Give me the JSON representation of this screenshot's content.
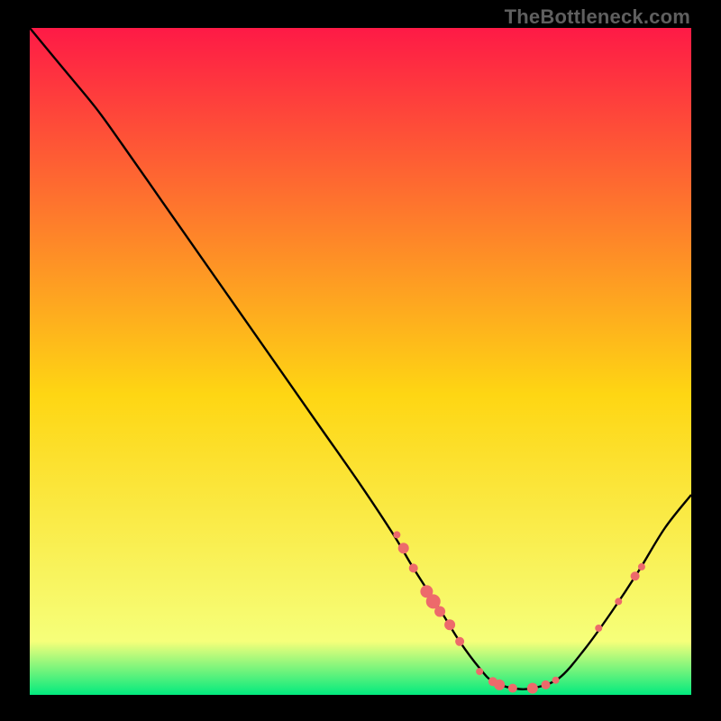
{
  "watermark": "TheBottleneck.com",
  "colors": {
    "grad_top": "#fe1a46",
    "grad_mid": "#fed613",
    "grad_bot": "#02ea7e",
    "curve": "#000000",
    "marker": "#ed6a6b",
    "frame": "#000000"
  },
  "chart_data": {
    "type": "line",
    "title": "",
    "xlabel": "",
    "ylabel": "",
    "xlim": [
      0,
      100
    ],
    "ylim": [
      0,
      100
    ],
    "series": [
      {
        "name": "bottleneck-curve",
        "x": [
          0,
          5,
          10,
          14,
          20,
          26,
          32,
          38,
          44,
          50,
          55,
          58,
          62,
          65,
          68,
          70,
          73,
          76,
          80,
          84,
          88,
          92,
          96,
          100
        ],
        "y": [
          100,
          94,
          88,
          82.5,
          74,
          65.5,
          57,
          48.5,
          40,
          31.5,
          24,
          19,
          12.8,
          8,
          4,
          2,
          1,
          1,
          2.5,
          7,
          12.5,
          18.5,
          25,
          30
        ]
      }
    ],
    "markers": [
      {
        "x": 55.5,
        "y": 24.0,
        "r": 4
      },
      {
        "x": 56.5,
        "y": 22.0,
        "r": 6
      },
      {
        "x": 58.0,
        "y": 19.0,
        "r": 5
      },
      {
        "x": 60.0,
        "y": 15.5,
        "r": 7
      },
      {
        "x": 61.0,
        "y": 14.0,
        "r": 8
      },
      {
        "x": 62.0,
        "y": 12.5,
        "r": 6
      },
      {
        "x": 63.5,
        "y": 10.5,
        "r": 6
      },
      {
        "x": 65.0,
        "y": 8.0,
        "r": 5
      },
      {
        "x": 68.0,
        "y": 3.5,
        "r": 4
      },
      {
        "x": 70.0,
        "y": 2.0,
        "r": 5
      },
      {
        "x": 71.0,
        "y": 1.5,
        "r": 6
      },
      {
        "x": 73.0,
        "y": 1.0,
        "r": 5
      },
      {
        "x": 76.0,
        "y": 1.0,
        "r": 6
      },
      {
        "x": 78.0,
        "y": 1.5,
        "r": 5
      },
      {
        "x": 79.5,
        "y": 2.2,
        "r": 4
      },
      {
        "x": 86.0,
        "y": 10.0,
        "r": 4
      },
      {
        "x": 89.0,
        "y": 14.0,
        "r": 4
      },
      {
        "x": 91.5,
        "y": 17.8,
        "r": 5
      },
      {
        "x": 92.5,
        "y": 19.2,
        "r": 4
      }
    ]
  }
}
